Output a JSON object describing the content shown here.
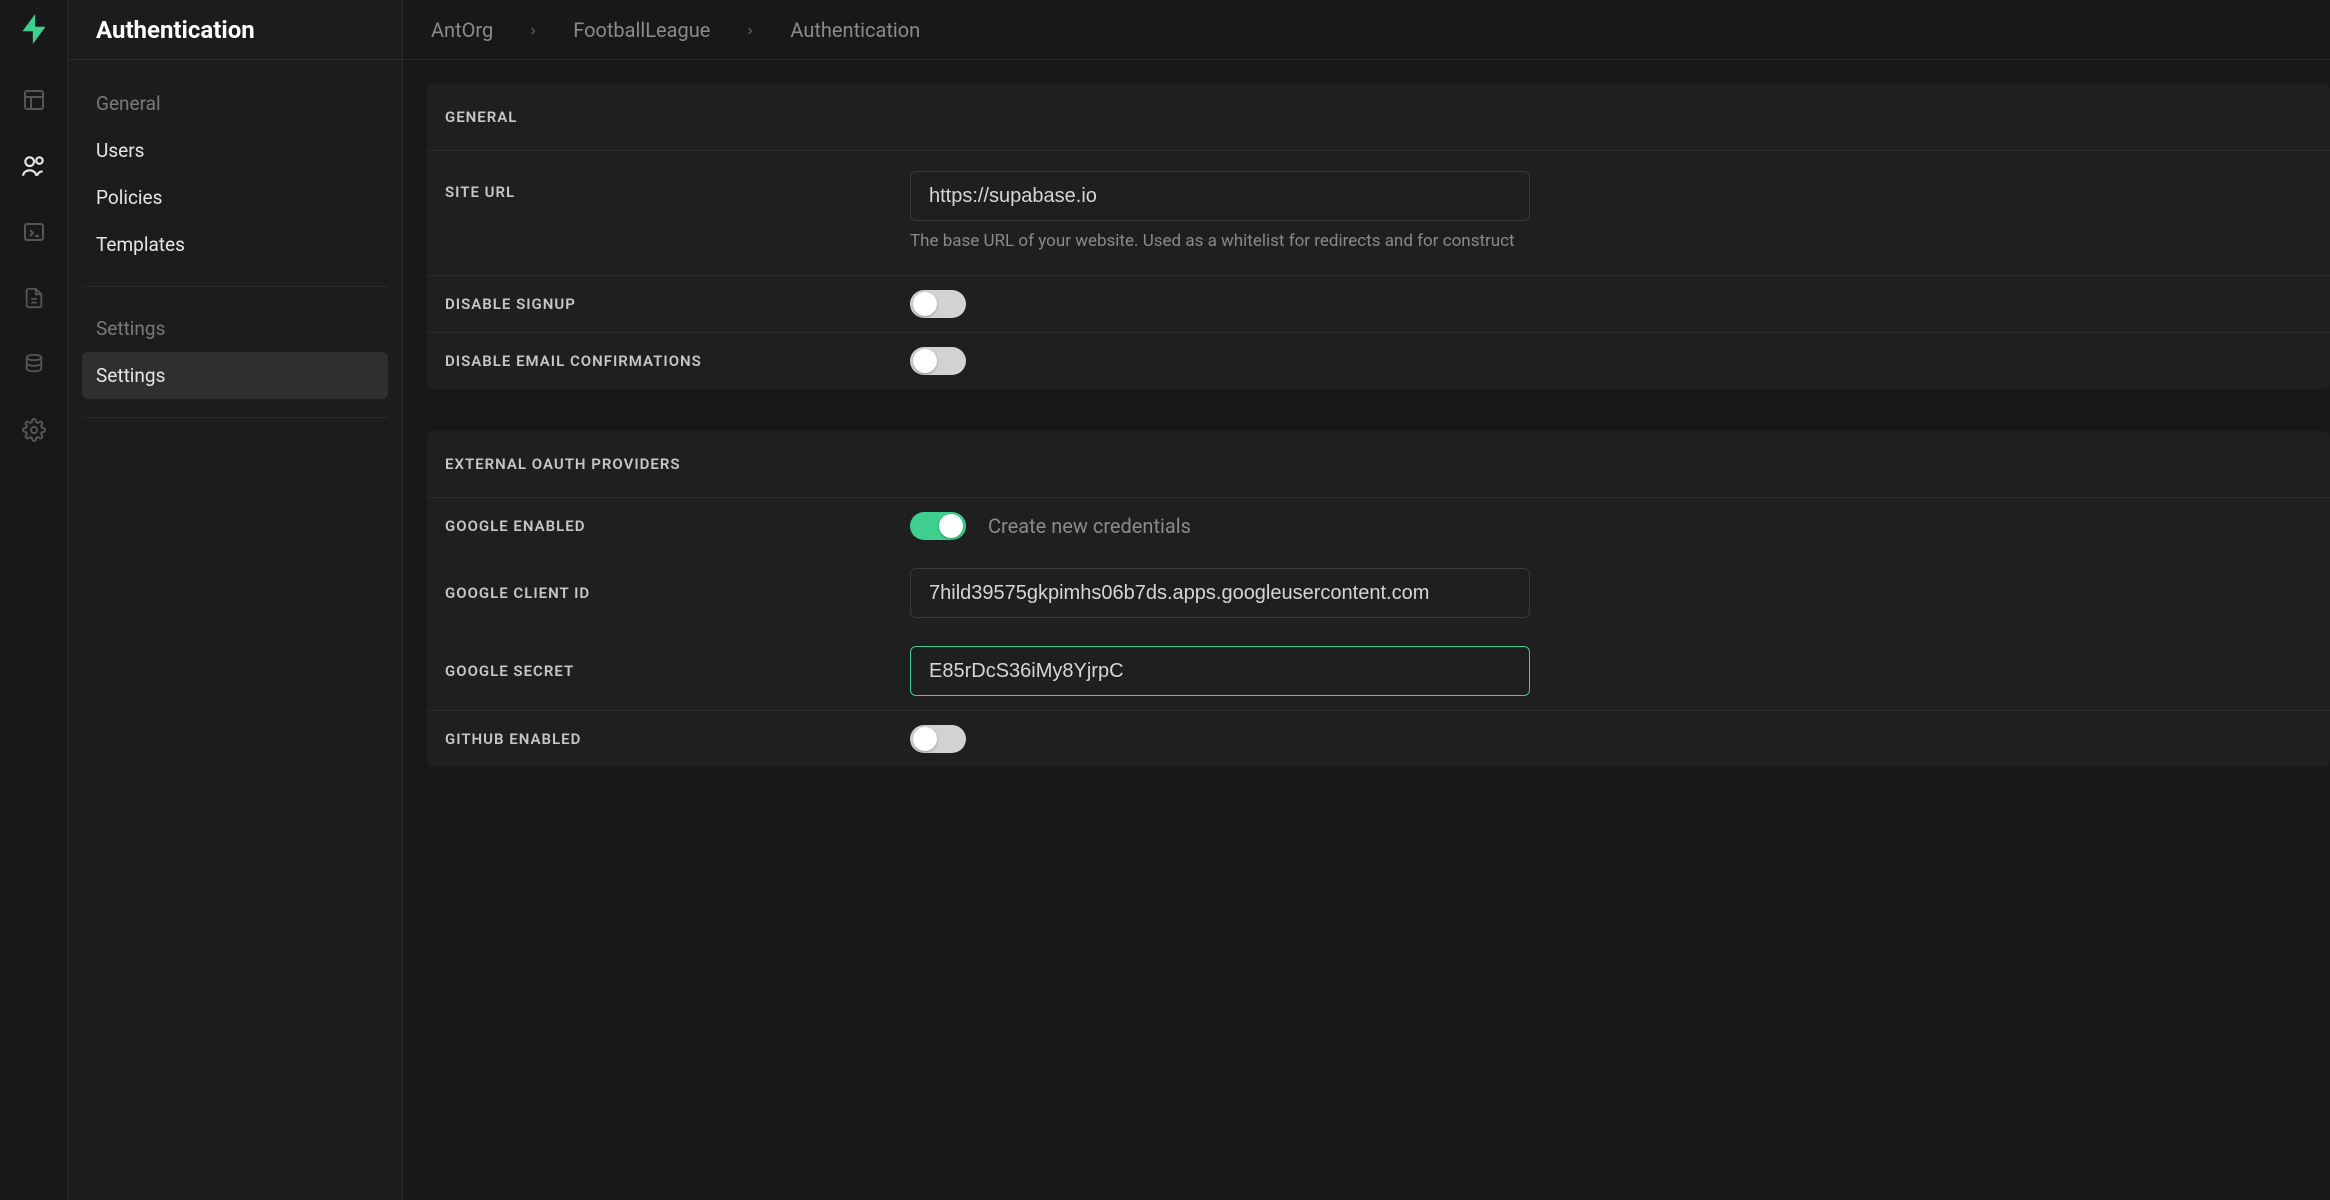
{
  "header": {
    "title": "Authentication"
  },
  "breadcrumb": {
    "items": [
      "AntOrg",
      "FootballLeague",
      "Authentication"
    ]
  },
  "sidebar": {
    "group1_label": "General",
    "group1": [
      {
        "label": "Users"
      },
      {
        "label": "Policies"
      },
      {
        "label": "Templates"
      }
    ],
    "group2_label": "Settings",
    "group2": [
      {
        "label": "Settings",
        "active": true
      }
    ]
  },
  "general_section": {
    "heading": "GENERAL",
    "site_url_label": "SITE URL",
    "site_url_value": "https://supabase.io",
    "site_url_help": "The base URL of your website. Used as a whitelist for redirects and for construct",
    "disable_signup_label": "DISABLE SIGNUP",
    "disable_signup_on": false,
    "disable_email_conf_label": "DISABLE EMAIL CONFIRMATIONS",
    "disable_email_conf_on": false
  },
  "oauth_section": {
    "heading": "EXTERNAL OAUTH PROVIDERS",
    "google_enabled_label": "GOOGLE ENABLED",
    "google_enabled_on": true,
    "create_credentials_label": "Create new credentials",
    "google_client_id_label": "GOOGLE CLIENT ID",
    "google_client_id_value": "7hild39575gkpimhs06b7ds.apps.googleusercontent.com",
    "google_secret_label": "GOOGLE SECRET",
    "google_secret_value": "E85rDcS36iMy8YjrpC",
    "github_enabled_label": "GITHUB ENABLED",
    "github_enabled_on": false
  },
  "colors": {
    "accent": "#3ecf8e"
  }
}
